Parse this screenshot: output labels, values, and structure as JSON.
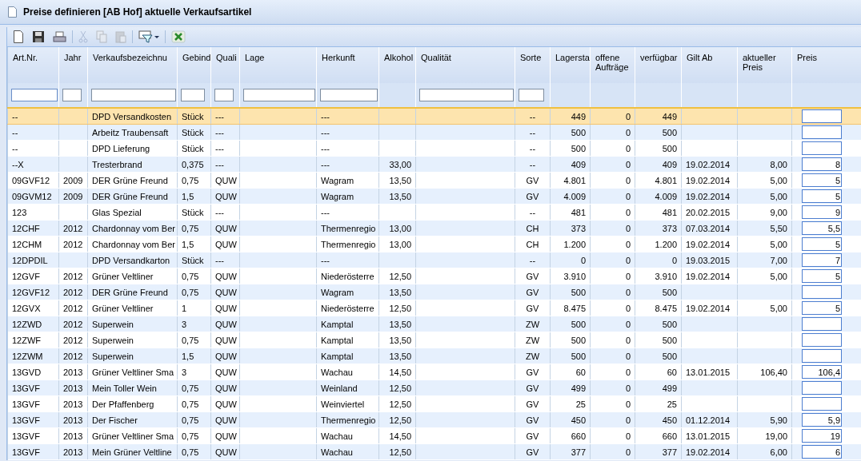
{
  "window": {
    "title": "Preise definieren [AB Hof] aktuelle Verkaufsartikel"
  },
  "toolbar": [
    {
      "kind": "new",
      "disabled": false
    },
    {
      "kind": "save",
      "disabled": false
    },
    {
      "kind": "print",
      "disabled": false
    },
    {
      "kind": "sep"
    },
    {
      "kind": "cut",
      "disabled": true
    },
    {
      "kind": "copy",
      "disabled": true
    },
    {
      "kind": "paste",
      "disabled": true
    },
    {
      "kind": "sep"
    },
    {
      "kind": "filter",
      "disabled": false
    },
    {
      "kind": "sep"
    },
    {
      "kind": "excel",
      "disabled": false
    }
  ],
  "table": {
    "columns": [
      {
        "label": "Art.Nr.",
        "filter": true
      },
      {
        "label": "Jahr",
        "filter": true
      },
      {
        "label": "Verkaufsbezeichnu",
        "filter": true
      },
      {
        "label": "Gebind",
        "filter": true
      },
      {
        "label": "Quali",
        "filter": true
      },
      {
        "label": "Lage",
        "filter": true
      },
      {
        "label": "Herkunft",
        "filter": true
      },
      {
        "label": "Alkohol",
        "filter": false
      },
      {
        "label": "Qualität",
        "filter": true
      },
      {
        "label": "Sorte",
        "filter": true
      },
      {
        "label": "Lagersta",
        "filter": false
      },
      {
        "label": "offene Aufträge",
        "filter": false
      },
      {
        "label": "verfügbar",
        "filter": false
      },
      {
        "label": "Gilt Ab",
        "filter": false
      },
      {
        "label": "aktueller Preis",
        "filter": false
      },
      {
        "label": "Preis",
        "filter": false
      }
    ],
    "rows": [
      {
        "selected": true,
        "cells": [
          "--",
          "",
          "DPD Versandkosten",
          "Stück",
          "---",
          "",
          "---",
          "",
          "",
          "--",
          "449",
          "0",
          "449",
          "",
          ""
        ],
        "price": ""
      },
      {
        "selected": false,
        "cells": [
          "--",
          "",
          "Arbeitz Traubensaft",
          "Stück",
          "---",
          "",
          "---",
          "",
          "",
          "--",
          "500",
          "0",
          "500",
          "",
          ""
        ],
        "price": ""
      },
      {
        "selected": false,
        "cells": [
          "--",
          "",
          "DPD Lieferung",
          "Stück",
          "---",
          "",
          "---",
          "",
          "",
          "--",
          "500",
          "0",
          "500",
          "",
          ""
        ],
        "price": ""
      },
      {
        "selected": false,
        "cells": [
          "--X",
          "",
          "Tresterbrand",
          "0,375",
          "---",
          "",
          "---",
          "33,00",
          "",
          "--",
          "409",
          "0",
          "409",
          "19.02.2014",
          "8,00"
        ],
        "price": "8"
      },
      {
        "selected": false,
        "cells": [
          "09GVF12",
          "2009",
          "DER Grüne Freund",
          "0,75",
          "QUW",
          "",
          "Wagram",
          "13,50",
          "",
          "GV",
          "4.801",
          "0",
          "4.801",
          "19.02.2014",
          "5,00"
        ],
        "price": "5"
      },
      {
        "selected": false,
        "cells": [
          "09GVM12",
          "2009",
          "DER Grüne Freund",
          "1,5",
          "QUW",
          "",
          "Wagram",
          "13,50",
          "",
          "GV",
          "4.009",
          "0",
          "4.009",
          "19.02.2014",
          "5,00"
        ],
        "price": "5"
      },
      {
        "selected": false,
        "cells": [
          "123",
          "",
          "Glas Spezial",
          "Stück",
          "---",
          "",
          "---",
          "",
          "",
          "--",
          "481",
          "0",
          "481",
          "20.02.2015",
          "9,00"
        ],
        "price": "9"
      },
      {
        "selected": false,
        "cells": [
          "12CHF",
          "2012",
          "Chardonnay vom Ber",
          "0,75",
          "QUW",
          "",
          "Thermenregio",
          "13,00",
          "",
          "CH",
          "373",
          "0",
          "373",
          "07.03.2014",
          "5,50"
        ],
        "price": "5,5"
      },
      {
        "selected": false,
        "cells": [
          "12CHM",
          "2012",
          "Chardonnay vom Ber",
          "1,5",
          "QUW",
          "",
          "Thermenregio",
          "13,00",
          "",
          "CH",
          "1.200",
          "0",
          "1.200",
          "19.02.2014",
          "5,00"
        ],
        "price": "5"
      },
      {
        "selected": false,
        "cells": [
          "12DPDIL",
          "",
          "DPD Versandkarton",
          "Stück",
          "---",
          "",
          "---",
          "",
          "",
          "--",
          "0",
          "0",
          "0",
          "19.03.2015",
          "7,00"
        ],
        "price": "7"
      },
      {
        "selected": false,
        "cells": [
          "12GVF",
          "2012",
          "Grüner Veltliner",
          "0,75",
          "QUW",
          "",
          "Niederösterre",
          "12,50",
          "",
          "GV",
          "3.910",
          "0",
          "3.910",
          "19.02.2014",
          "5,00"
        ],
        "price": "5"
      },
      {
        "selected": false,
        "cells": [
          "12GVF12",
          "2012",
          "DER Grüne Freund",
          "0,75",
          "QUW",
          "",
          "Wagram",
          "13,50",
          "",
          "GV",
          "500",
          "0",
          "500",
          "",
          ""
        ],
        "price": ""
      },
      {
        "selected": false,
        "cells": [
          "12GVX",
          "2012",
          "Grüner Veltliner",
          "1",
          "QUW",
          "",
          "Niederösterre",
          "12,50",
          "",
          "GV",
          "8.475",
          "0",
          "8.475",
          "19.02.2014",
          "5,00"
        ],
        "price": "5"
      },
      {
        "selected": false,
        "cells": [
          "12ZWD",
          "2012",
          "Superwein",
          "3",
          "QUW",
          "",
          "Kamptal",
          "13,50",
          "",
          "ZW",
          "500",
          "0",
          "500",
          "",
          ""
        ],
        "price": ""
      },
      {
        "selected": false,
        "cells": [
          "12ZWF",
          "2012",
          "Superwein",
          "0,75",
          "QUW",
          "",
          "Kamptal",
          "13,50",
          "",
          "ZW",
          "500",
          "0",
          "500",
          "",
          ""
        ],
        "price": ""
      },
      {
        "selected": false,
        "cells": [
          "12ZWM",
          "2012",
          "Superwein",
          "1,5",
          "QUW",
          "",
          "Kamptal",
          "13,50",
          "",
          "ZW",
          "500",
          "0",
          "500",
          "",
          ""
        ],
        "price": ""
      },
      {
        "selected": false,
        "cells": [
          "13GVD",
          "2013",
          "Grüner Veltliner Sma",
          "3",
          "QUW",
          "",
          "Wachau",
          "14,50",
          "",
          "GV",
          "60",
          "0",
          "60",
          "13.01.2015",
          "106,40"
        ],
        "price": "106,4"
      },
      {
        "selected": false,
        "cells": [
          "13GVF",
          "2013",
          "Mein Toller Wein",
          "0,75",
          "QUW",
          "",
          "Weinland",
          "12,50",
          "",
          "GV",
          "499",
          "0",
          "499",
          "",
          ""
        ],
        "price": ""
      },
      {
        "selected": false,
        "cells": [
          "13GVF",
          "2013",
          "Der Pfaffenberg",
          "0,75",
          "QUW",
          "",
          "Weinviertel",
          "12,50",
          "",
          "GV",
          "25",
          "0",
          "25",
          "",
          ""
        ],
        "price": ""
      },
      {
        "selected": false,
        "cells": [
          "13GVF",
          "2013",
          "Der Fischer",
          "0,75",
          "QUW",
          "",
          "Thermenregio",
          "12,50",
          "",
          "GV",
          "450",
          "0",
          "450",
          "01.12.2014",
          "5,90"
        ],
        "price": "5,9"
      },
      {
        "selected": false,
        "cells": [
          "13GVF",
          "2013",
          "Grüner Veltliner Sma",
          "0,75",
          "QUW",
          "",
          "Wachau",
          "14,50",
          "",
          "GV",
          "660",
          "0",
          "660",
          "13.01.2015",
          "19,00"
        ],
        "price": "19"
      },
      {
        "selected": false,
        "cells": [
          "13GVF",
          "2013",
          "Mein Grüner Veltline",
          "0,75",
          "QUW",
          "",
          "Wachau",
          "12,50",
          "",
          "GV",
          "377",
          "0",
          "377",
          "19.02.2014",
          "6,00"
        ],
        "price": "6"
      }
    ]
  }
}
